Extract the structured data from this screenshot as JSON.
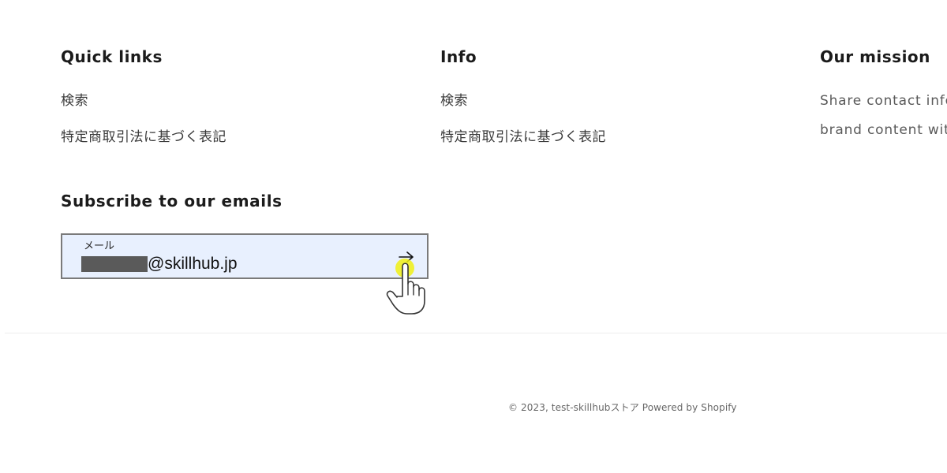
{
  "footer": {
    "columns": [
      {
        "heading": "Quick links",
        "links": [
          "検索",
          "特定商取引法に基づく表記"
        ]
      },
      {
        "heading": "Info",
        "links": [
          "検索",
          "特定商取引法に基づく表記"
        ]
      },
      {
        "heading": "Our mission",
        "text_lines": [
          "Share contact info",
          "brand content wit"
        ]
      }
    ],
    "subscribe": {
      "heading": "Subscribe to our emails",
      "field_label": "メール",
      "field_value_visible": "@skillhub.jp",
      "submit_icon": "arrow-right-icon"
    },
    "copyright": {
      "text": "© 2023, test-skillhubストア",
      "powered_by": "Powered by Shopify"
    }
  },
  "colors": {
    "field_background": "#e8f0fe",
    "field_border": "#7a7a7a",
    "cursor_highlight": "#f0f014"
  }
}
